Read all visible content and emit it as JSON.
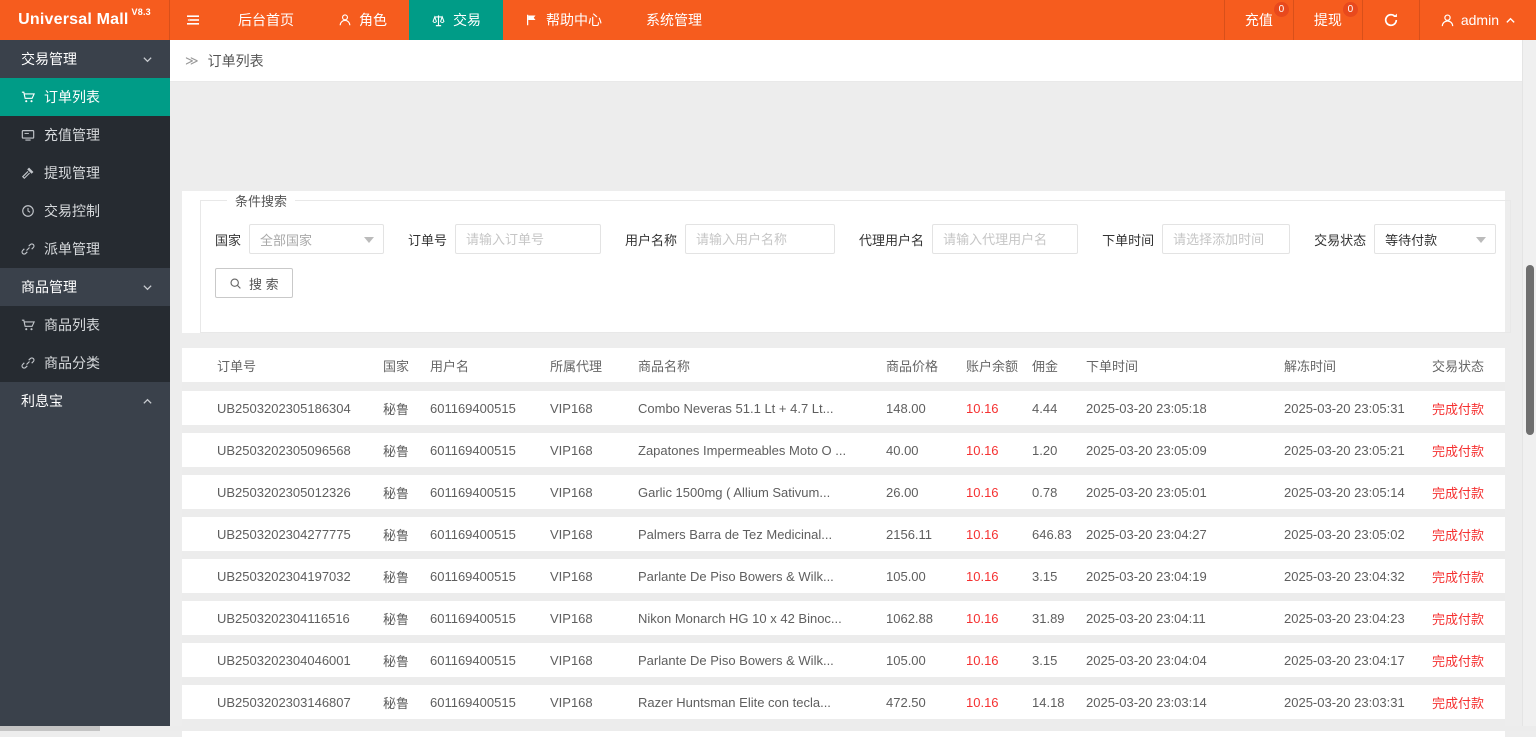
{
  "colors": {
    "orange": "#f65c1e",
    "badge": "#e8491d",
    "teal": "#009c87",
    "red": "#f53131",
    "side": "#3a414b",
    "side-dark": "#262b31"
  },
  "app": {
    "title": "Universal Mall",
    "version": "V8.3"
  },
  "topnav": {
    "items": [
      {
        "name": "home",
        "label": "后台首页",
        "icon": null,
        "active": false
      },
      {
        "name": "roles",
        "label": "角色",
        "icon": "user",
        "active": false
      },
      {
        "name": "trade",
        "label": "交易",
        "icon": "scale",
        "active": true
      },
      {
        "name": "help-center",
        "label": "帮助中心",
        "icon": "flag",
        "active": false
      },
      {
        "name": "system",
        "label": "系统管理",
        "icon": null,
        "active": false
      }
    ]
  },
  "header_right": {
    "recharge": {
      "label": "充值",
      "badge": "0"
    },
    "withdraw": {
      "label": "提现",
      "badge": "0"
    },
    "username": "admin"
  },
  "sidebar": {
    "groups": [
      {
        "name": "trade-mgmt",
        "label": "交易管理",
        "expanded": true,
        "items": [
          {
            "name": "order-list",
            "label": "订单列表",
            "icon": "cart",
            "active": true
          },
          {
            "name": "recharge-mgmt",
            "label": "充值管理",
            "icon": "card",
            "active": false
          },
          {
            "name": "withdraw-mgmt",
            "label": "提现管理",
            "icon": "gavel",
            "active": false
          },
          {
            "name": "trade-control",
            "label": "交易控制",
            "icon": "clock",
            "active": false
          },
          {
            "name": "dispatch-mgmt",
            "label": "派单管理",
            "icon": "link",
            "active": false
          }
        ]
      },
      {
        "name": "product-mgmt",
        "label": "商品管理",
        "expanded": true,
        "items": [
          {
            "name": "product-list",
            "label": "商品列表",
            "icon": "cart",
            "active": false
          },
          {
            "name": "product-category",
            "label": "商品分类",
            "icon": "link",
            "active": false
          }
        ]
      },
      {
        "name": "interest-treasure",
        "label": "利息宝",
        "expanded": false,
        "items": []
      }
    ]
  },
  "breadcrumb": {
    "prefix": "≫",
    "label": "订单列表"
  },
  "search": {
    "legend": "条件搜索",
    "fields": [
      {
        "name": "country",
        "label": "国家",
        "type": "select",
        "value": "全部国家",
        "muted": true
      },
      {
        "name": "order-no",
        "label": "订单号",
        "type": "input",
        "placeholder": "请输入订单号"
      },
      {
        "name": "username",
        "label": "用户名称",
        "type": "input",
        "placeholder": "请输入用户名称"
      },
      {
        "name": "agent-username",
        "label": "代理用户名",
        "type": "input",
        "placeholder": "请输入代理用户名"
      },
      {
        "name": "order-time",
        "label": "下单时间",
        "type": "input",
        "placeholder": "请选择添加时间"
      },
      {
        "name": "trade-status",
        "label": "交易状态",
        "type": "select",
        "value": "等待付款",
        "muted": false
      }
    ],
    "button_label": "搜 索"
  },
  "table": {
    "headers": [
      "订单号",
      "国家",
      "用户名",
      "所属代理",
      "商品名称",
      "商品价格",
      "账户余额",
      "佣金",
      "下单时间",
      "解冻时间",
      "交易状态"
    ],
    "rows": [
      [
        "UB2503202305186304",
        "秘鲁",
        "601169400515",
        "VIP168",
        "Combo Neveras 51.1 Lt + 4.7 Lt...",
        "148.00",
        "10.16",
        "4.44",
        "2025-03-20 23:05:18",
        "2025-03-20 23:05:31",
        "完成付款"
      ],
      [
        "UB2503202305096568",
        "秘鲁",
        "601169400515",
        "VIP168",
        "Zapatones Impermeables Moto O ...",
        "40.00",
        "10.16",
        "1.20",
        "2025-03-20 23:05:09",
        "2025-03-20 23:05:21",
        "完成付款"
      ],
      [
        "UB2503202305012326",
        "秘鲁",
        "601169400515",
        "VIP168",
        "Garlic 1500mg ( Allium Sativum...",
        "26.00",
        "10.16",
        "0.78",
        "2025-03-20 23:05:01",
        "2025-03-20 23:05:14",
        "完成付款"
      ],
      [
        "UB2503202304277775",
        "秘鲁",
        "601169400515",
        "VIP168",
        "Palmers Barra de Tez Medicinal...",
        "2156.11",
        "10.16",
        "646.83",
        "2025-03-20 23:04:27",
        "2025-03-20 23:05:02",
        "完成付款"
      ],
      [
        "UB2503202304197032",
        "秘鲁",
        "601169400515",
        "VIP168",
        "Parlante De Piso Bowers & Wilk...",
        "105.00",
        "10.16",
        "3.15",
        "2025-03-20 23:04:19",
        "2025-03-20 23:04:32",
        "完成付款"
      ],
      [
        "UB2503202304116516",
        "秘鲁",
        "601169400515",
        "VIP168",
        "Nikon Monarch HG 10 x 42 Binoc...",
        "1062.88",
        "10.16",
        "31.89",
        "2025-03-20 23:04:11",
        "2025-03-20 23:04:23",
        "完成付款"
      ],
      [
        "UB2503202304046001",
        "秘鲁",
        "601169400515",
        "VIP168",
        "Parlante De Piso Bowers & Wilk...",
        "105.00",
        "10.16",
        "3.15",
        "2025-03-20 23:04:04",
        "2025-03-20 23:04:17",
        "完成付款"
      ],
      [
        "UB2503202303146807",
        "秘鲁",
        "601169400515",
        "VIP168",
        "Razer Huntsman Elite con tecla...",
        "472.50",
        "10.16",
        "14.18",
        "2025-03-20 23:03:14",
        "2025-03-20 23:03:31",
        "完成付款"
      ]
    ]
  }
}
